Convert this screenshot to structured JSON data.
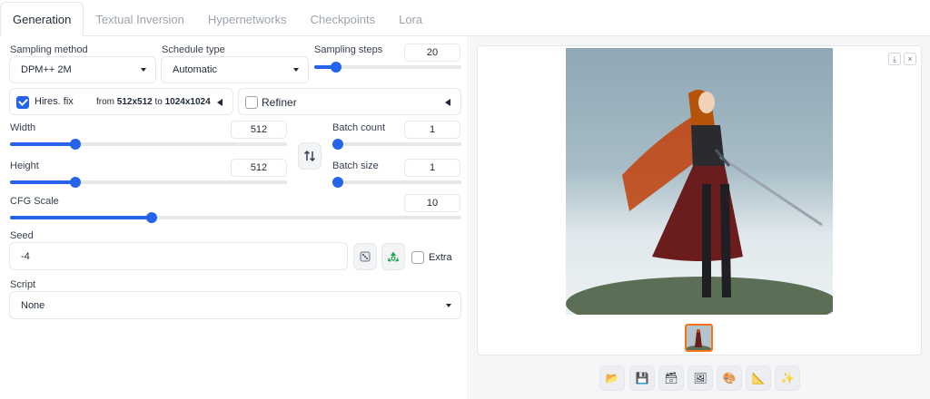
{
  "tabs": [
    "Generation",
    "Textual Inversion",
    "Hypernetworks",
    "Checkpoints",
    "Lora"
  ],
  "sampling_method": {
    "label": "Sampling method",
    "value": "DPM++ 2M"
  },
  "schedule_type": {
    "label": "Schedule type",
    "value": "Automatic"
  },
  "sampling_steps": {
    "label": "Sampling steps",
    "value": "20",
    "min": 1,
    "max": 150,
    "level": 20
  },
  "hires": {
    "label": "Hires. fix",
    "checked": true,
    "from_label": "from",
    "from_value": "512x512",
    "to_label": "to",
    "to_value": "1024x1024"
  },
  "refiner": {
    "label": "Refiner",
    "checked": false
  },
  "width": {
    "label": "Width",
    "value": "512",
    "fraction": 0.22
  },
  "height": {
    "label": "Height",
    "value": "512",
    "fraction": 0.22
  },
  "batch_count": {
    "label": "Batch count",
    "value": "1",
    "fraction": 0.0
  },
  "batch_size": {
    "label": "Batch size",
    "value": "1",
    "fraction": 0.0
  },
  "cfg_scale": {
    "label": "CFG Scale",
    "value": "10",
    "fraction": 0.32
  },
  "seed": {
    "label": "Seed",
    "value": "-4",
    "extra_label": "Extra"
  },
  "script": {
    "label": "Script",
    "value": "None"
  },
  "colors": {
    "accent": "#2563eb",
    "selected_thumb": "#f97316"
  },
  "icons": {
    "swap": "swap-arrows-icon",
    "dice": "dice-icon",
    "recycle": "recycle-icon",
    "download": "download-icon",
    "close": "close-icon",
    "toolbar": [
      "folder-icon",
      "save-icon",
      "zip-icon",
      "image-icon",
      "palette-icon",
      "ruler-icon",
      "sparkle-icon"
    ]
  },
  "toolbar_glyphs": [
    "📂",
    "💾",
    "🗃",
    "🖼",
    "🎨",
    "📐",
    "✨"
  ]
}
